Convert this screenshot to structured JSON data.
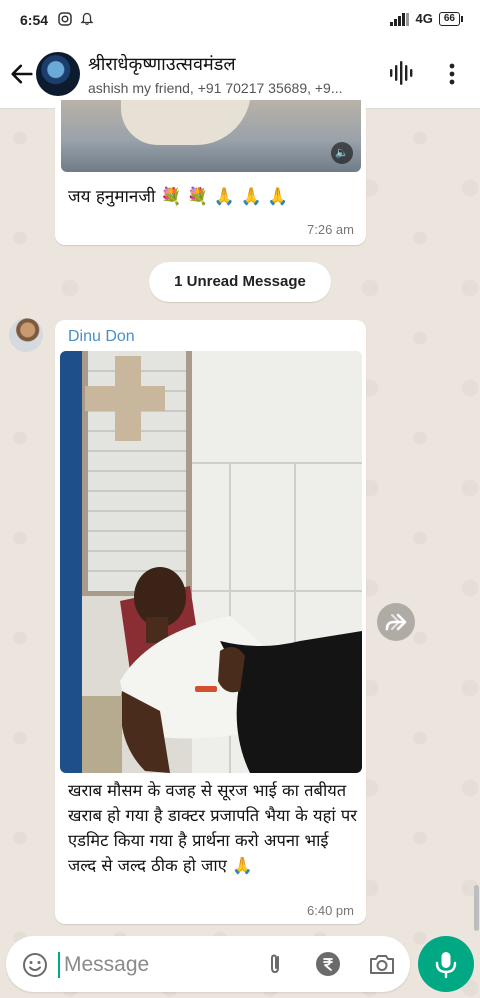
{
  "status_bar": {
    "time": "6:54",
    "network": "4G",
    "battery": "66"
  },
  "header": {
    "title": "श्रीराधेकृष्णाउत्सवमंडल",
    "subtitle": "ashish my friend, +91 70217 35689, +9..."
  },
  "messages": [
    {
      "text": "जय हनुमानजी 💐 💐 🙏 🙏 🙏",
      "time": "7:26 am"
    },
    {
      "sender": "Dinu Don",
      "text": "खराब मौसम के वजह से सूरज भाई का तबीयत खराब हो गया है डाक्टर प्रजापति भैया के यहां पर एडमिट किया गया है प्रार्थना करो अपना भाई जल्द से जल्द ठीक हो जाए 🙏",
      "time": "6:40 pm"
    }
  ],
  "unread_label": "1 Unread Message",
  "composer": {
    "placeholder": "Message"
  },
  "colors": {
    "accent": "#00a884",
    "sender_name": "#4a90c8",
    "bubble": "#ffffff",
    "wallpaper": "#ece5dd"
  },
  "icons": [
    "back-arrow-icon",
    "voice-call-icon",
    "more-options-icon",
    "volume-icon",
    "forward-icon",
    "emoji-icon",
    "attach-icon",
    "rupee-icon",
    "camera-icon",
    "mic-icon"
  ]
}
